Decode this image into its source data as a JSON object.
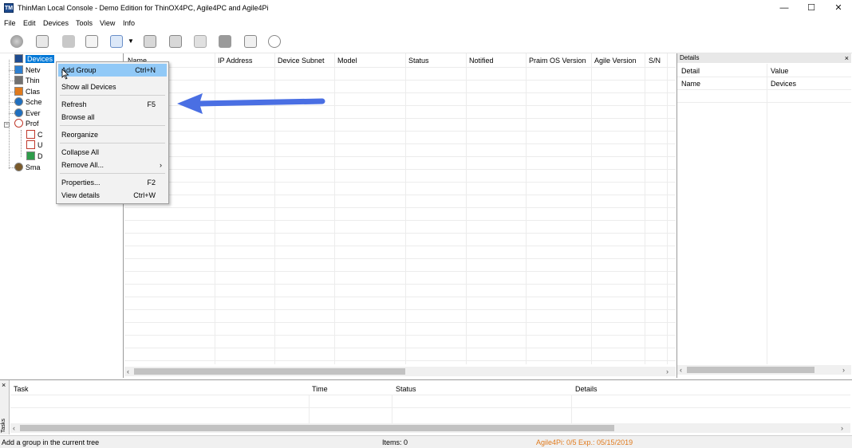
{
  "window": {
    "app_icon": "TM",
    "title": "ThinMan Local Console - Demo Edition for ThinOX4PC, Agile4PC and Agile4Pi",
    "minimize": "—",
    "maximize": "☐",
    "close": "✕"
  },
  "menu": [
    "File",
    "Edit",
    "Devices",
    "Tools",
    "View",
    "Info"
  ],
  "tree": {
    "items": [
      {
        "label": "Devices",
        "icon": "tm-icon",
        "color": "#1e4b8f"
      },
      {
        "label": "Netv",
        "icon": "network-icon",
        "color": "#2d7fd0"
      },
      {
        "label": "Thin",
        "icon": "thinos-icon",
        "color": "#707070"
      },
      {
        "label": "Clas",
        "icon": "class-icon",
        "color": "#e07a1c"
      },
      {
        "label": "Sche",
        "icon": "schedule-icon",
        "color": "#1f6fbf"
      },
      {
        "label": "Ever",
        "icon": "event-icon",
        "color": "#1f6fbf"
      },
      {
        "label": "Prof",
        "icon": "profile-icon",
        "color": "#c0392b"
      },
      {
        "label": "C",
        "icon": "profile-c-icon",
        "color": "#c0392b"
      },
      {
        "label": "U",
        "icon": "profile-u-icon",
        "color": "#c0392b"
      },
      {
        "label": "D",
        "icon": "profile-d-icon",
        "color": "#2e9c4a"
      },
      {
        "label": "Sma",
        "icon": "smart-icon",
        "color": "#7a5a2a"
      }
    ]
  },
  "list": {
    "columns": [
      "Name",
      "IP Address",
      "Device Subnet",
      "Model",
      "Status",
      "Notified",
      "Praim OS Version",
      "Agile Version",
      "S/N"
    ]
  },
  "context_menu": {
    "items": [
      {
        "label": "Add Group",
        "shortcut": "Ctrl+N"
      },
      {
        "label": "Show all Devices",
        "shortcut": ""
      },
      {
        "label": "Refresh",
        "shortcut": "F5"
      },
      {
        "label": "Browse all",
        "shortcut": ""
      },
      {
        "label": "Reorganize",
        "shortcut": ""
      },
      {
        "label": "Collapse All",
        "shortcut": ""
      },
      {
        "label": "Remove All...",
        "shortcut": "›"
      },
      {
        "label": "Properties...",
        "shortcut": "F2"
      },
      {
        "label": "View details",
        "shortcut": "Ctrl+W"
      }
    ]
  },
  "details": {
    "title": "Details",
    "close": "×",
    "col_detail": "Detail",
    "col_value": "Value",
    "row_name": "Name",
    "row_value": "Devices"
  },
  "tasks": {
    "tab_label": "Tasks",
    "close": "×",
    "columns": [
      "Task",
      "Time",
      "Status",
      "Details"
    ]
  },
  "status": {
    "hint": "Add a group in the current tree",
    "items": "Items: 0",
    "license": "Agile4Pi: 0/5 Exp.: 05/15/2019",
    "license_color": "#e07a1c"
  },
  "colors": {
    "selection": "#0078d7",
    "menu_highlight": "#91c9f7",
    "arrow": "#4a6fe3"
  }
}
